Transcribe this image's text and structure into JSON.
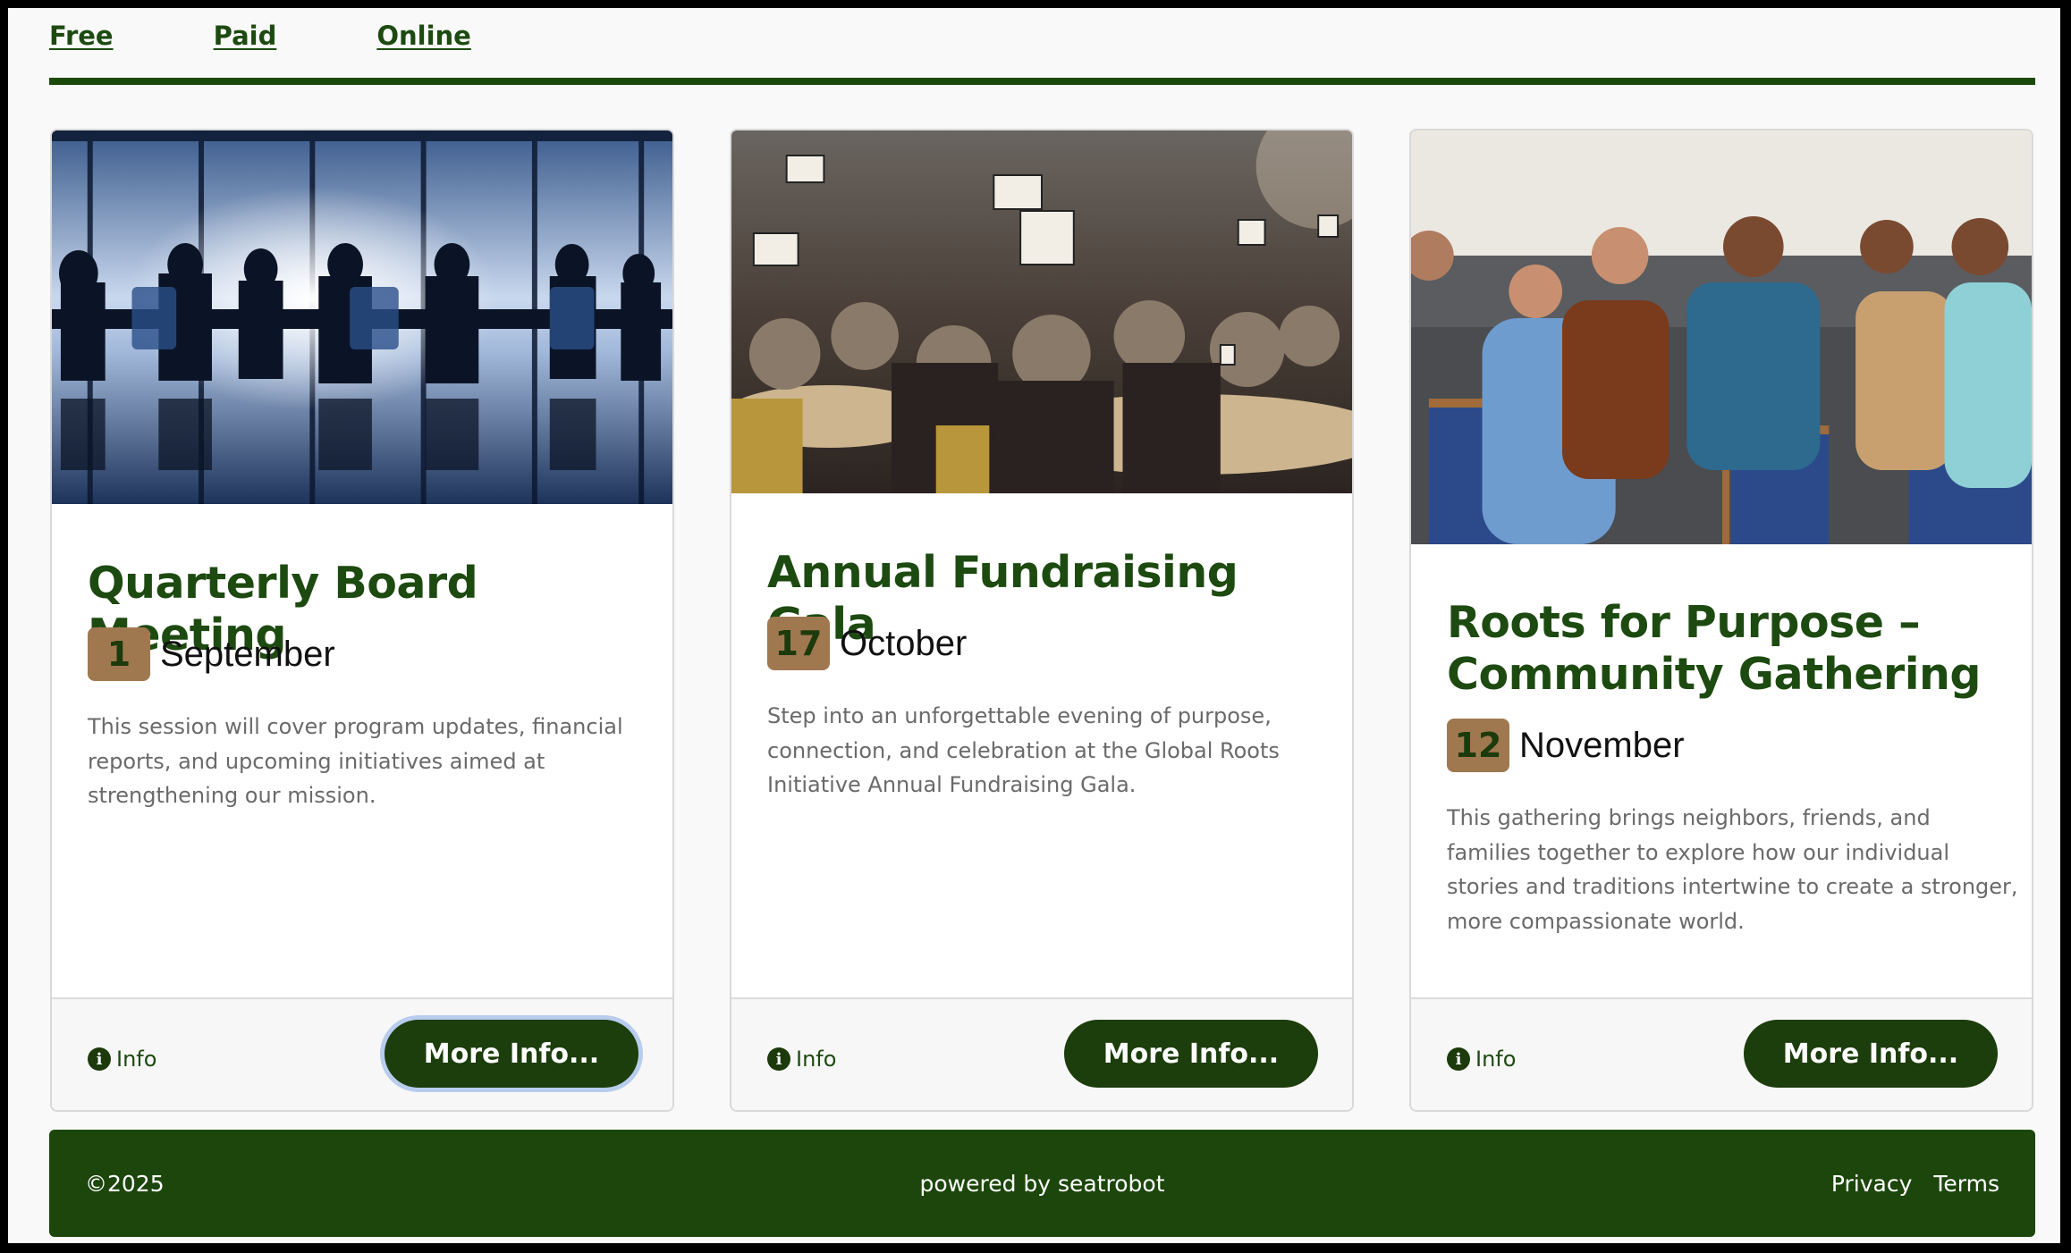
{
  "tabs": [
    {
      "label": "Free"
    },
    {
      "label": "Paid"
    },
    {
      "label": "Online"
    }
  ],
  "cards": [
    {
      "title": "Quarterly Board Meeting",
      "day": "1",
      "month": "September",
      "description": "This session will cover program updates, financial reports, and upcoming initiatives aimed at strengthening our mission.",
      "info_label": "Info",
      "button_label": "More Info..."
    },
    {
      "title": "Annual Fundraising Gala",
      "day": "17",
      "month": "October",
      "description": "Step into an unforgettable evening of purpose, connection, and celebration at the Global Roots Initiative Annual Fundraising Gala.",
      "info_label": "Info",
      "button_label": "More Info..."
    },
    {
      "title": "Roots for Purpose – Community Gathering",
      "day": "12",
      "month": "November",
      "description": "This gathering brings neighbors, friends, and families together to explore how our individual stories and traditions intertwine to create a stronger, more compassionate world.",
      "info_label": "Info",
      "button_label": "More Info..."
    }
  ],
  "footer": {
    "copyright": "©2025",
    "powered_by": "powered by seatrobot",
    "links": [
      {
        "label": "Privacy"
      },
      {
        "label": "Terms"
      }
    ]
  },
  "colors": {
    "brand_green": "#1d4a10",
    "footer_green": "#1c460b",
    "date_badge": "#a07850"
  }
}
